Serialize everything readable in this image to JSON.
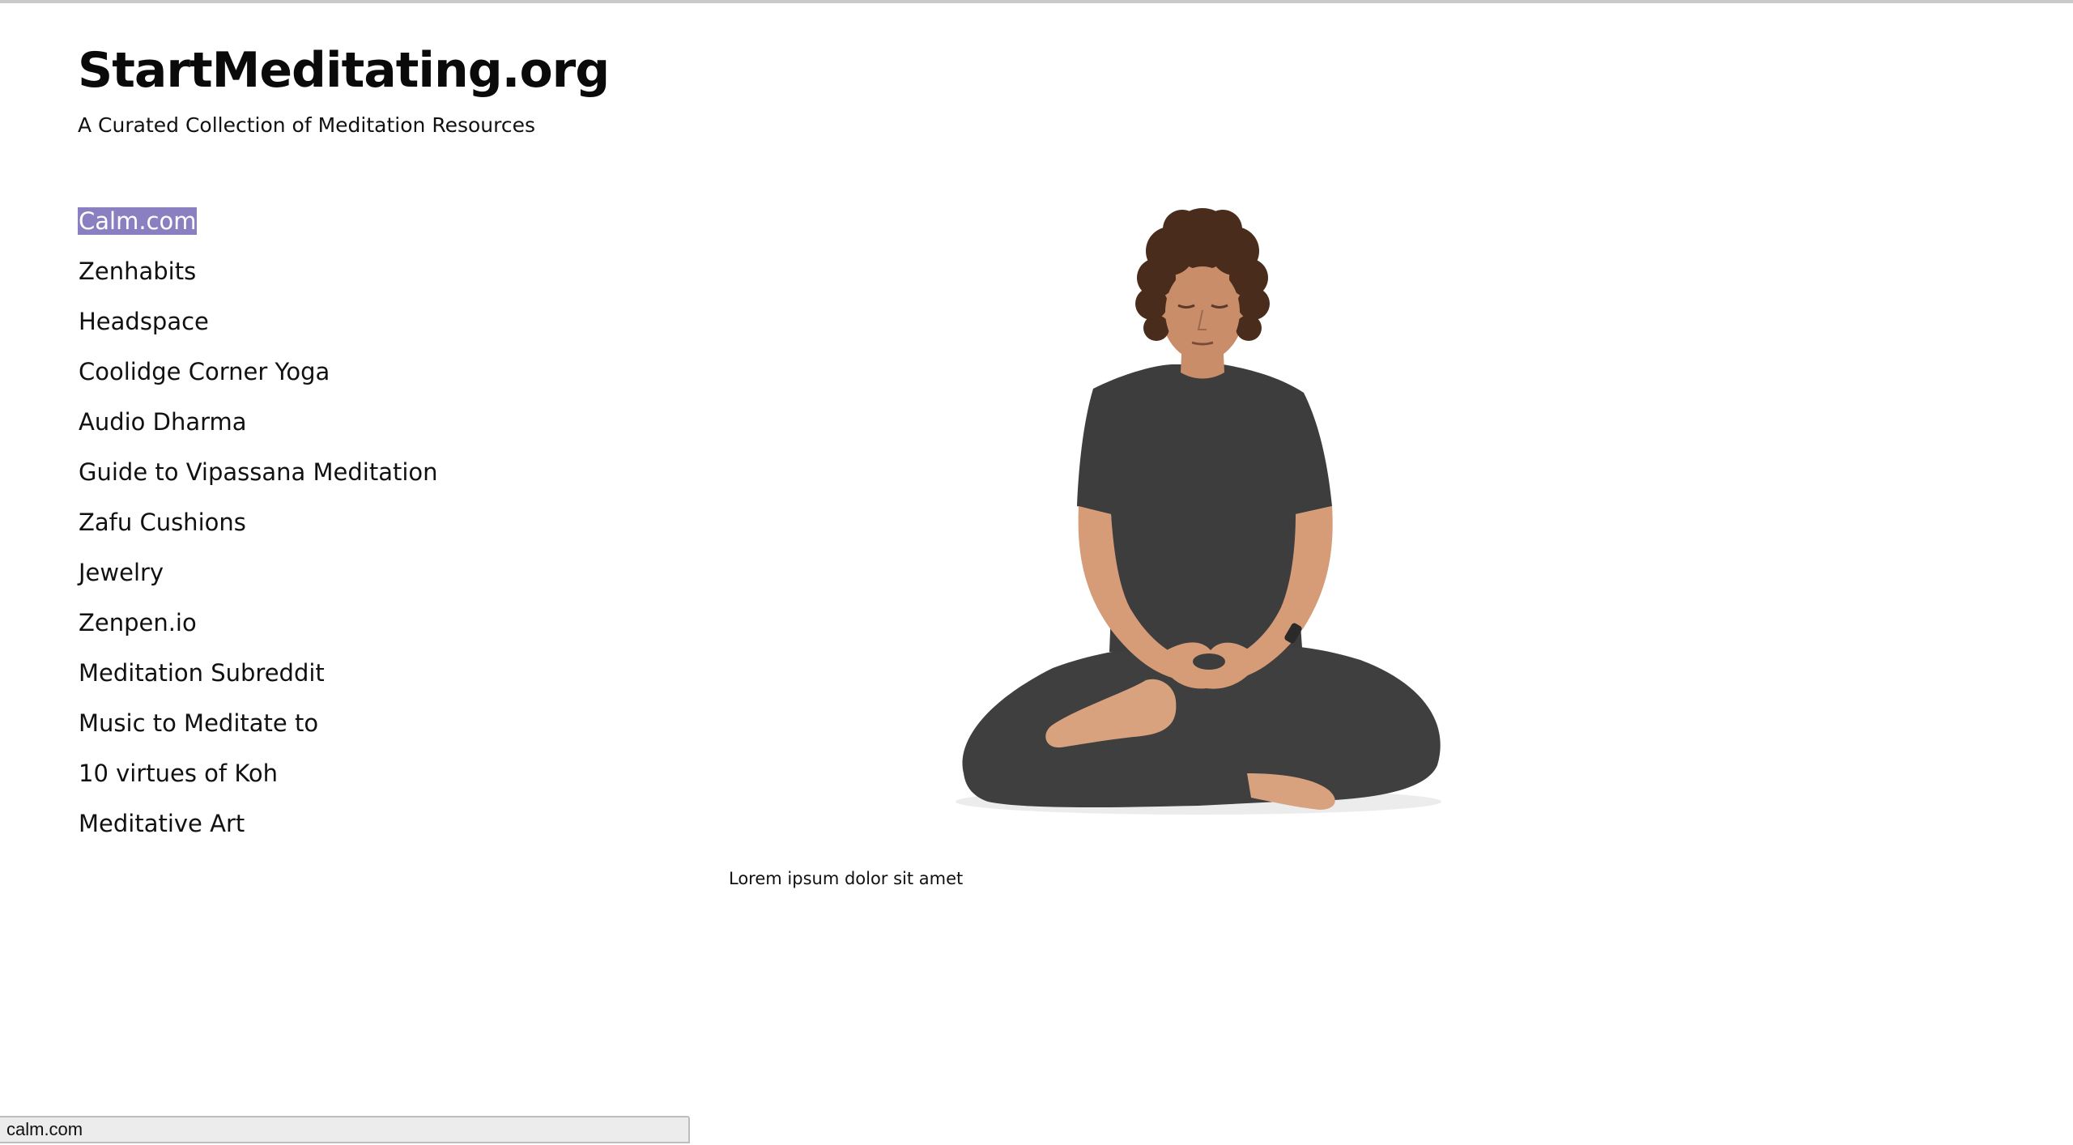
{
  "site": {
    "title": "StartMeditating.org",
    "tagline": "A Curated Collection of Meditation Resources"
  },
  "nav": {
    "items": [
      {
        "label": "Calm.com",
        "selected": true
      },
      {
        "label": "Zenhabits"
      },
      {
        "label": "Headspace"
      },
      {
        "label": "Coolidge Corner Yoga"
      },
      {
        "label": "Audio Dharma"
      },
      {
        "label": "Guide to Vipassana Meditation"
      },
      {
        "label": "Zafu Cushions"
      },
      {
        "label": "Jewelry"
      },
      {
        "label": "Zenpen.io"
      },
      {
        "label": "Meditation Subreddit"
      },
      {
        "label": "Music to Meditate to"
      },
      {
        "label": "10 virtues of Koh"
      },
      {
        "label": "Meditative Art"
      }
    ],
    "selected_highlight_color": "#8a7fc1"
  },
  "main": {
    "image": "person-meditating-lotus-pose",
    "caption": "Lorem ipsum dolor sit amet"
  },
  "status_bar": {
    "url": "calm.com"
  }
}
